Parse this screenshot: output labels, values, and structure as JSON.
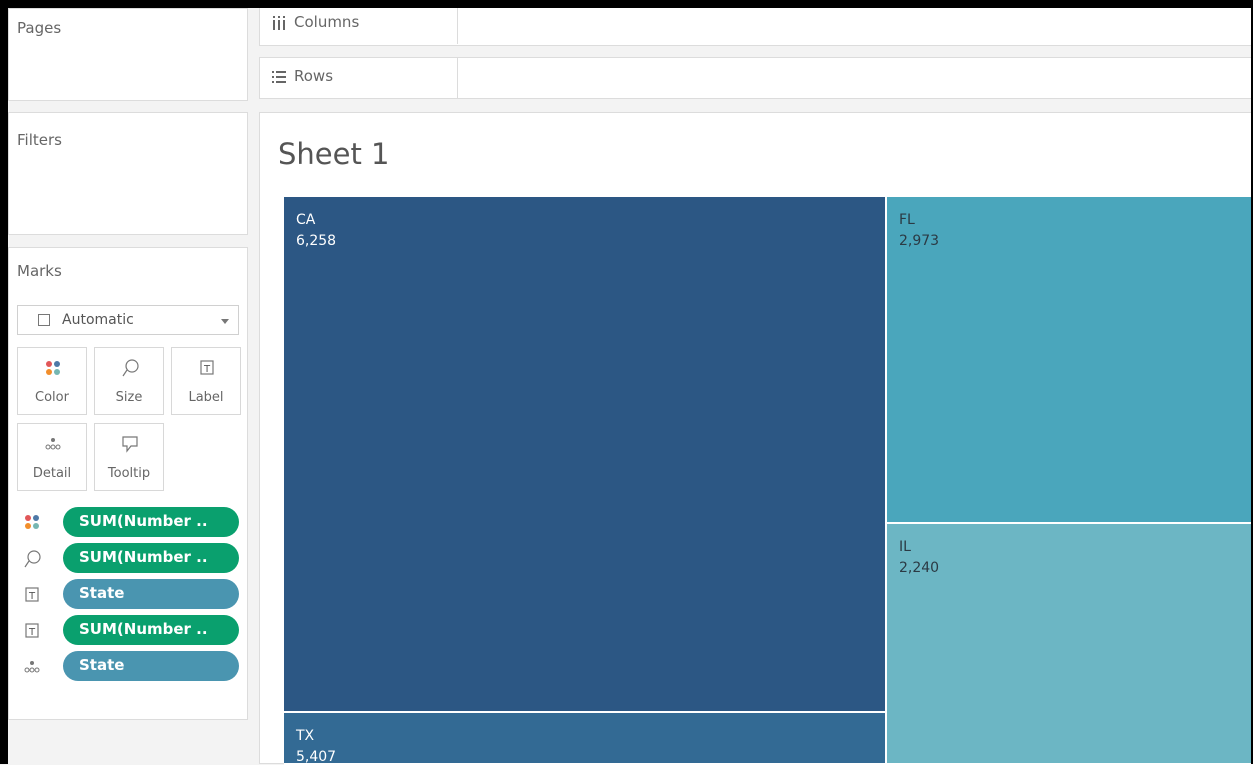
{
  "shelves": {
    "pages_label": "Pages",
    "filters_label": "Filters",
    "columns_label": "Columns",
    "rows_label": "Rows"
  },
  "marks": {
    "title": "Marks",
    "mark_type": "Automatic",
    "buttons": [
      {
        "label": "Color",
        "icon": "color-dots-icon"
      },
      {
        "label": "Size",
        "icon": "size-lasso-icon"
      },
      {
        "label": "Label",
        "icon": "label-t-icon"
      },
      {
        "label": "Detail",
        "icon": "detail-dots-icon"
      },
      {
        "label": "Tooltip",
        "icon": "tooltip-speech-icon"
      }
    ],
    "fields": [
      {
        "type": "color",
        "label": "SUM(Number ..",
        "color": "#0aa06e"
      },
      {
        "type": "size",
        "label": "SUM(Number ..",
        "color": "#0aa06e"
      },
      {
        "type": "label",
        "label": "State",
        "color": "#4a95b0"
      },
      {
        "type": "label",
        "label": "SUM(Number ..",
        "color": "#0aa06e"
      },
      {
        "type": "detail",
        "label": "State",
        "color": "#4a95b0"
      }
    ]
  },
  "sheet": {
    "title": "Sheet 1"
  },
  "chart_data": {
    "type": "treemap",
    "items": [
      {
        "state": "CA",
        "value": "6,258",
        "color": "#2c5784"
      },
      {
        "state": "FL",
        "value": "2,973",
        "color": "#4aa6bc"
      },
      {
        "state": "IL",
        "value": "2,240",
        "color": "#6cb6c4"
      },
      {
        "state": "TX",
        "value": "5,407",
        "color": "#336a94"
      }
    ]
  }
}
